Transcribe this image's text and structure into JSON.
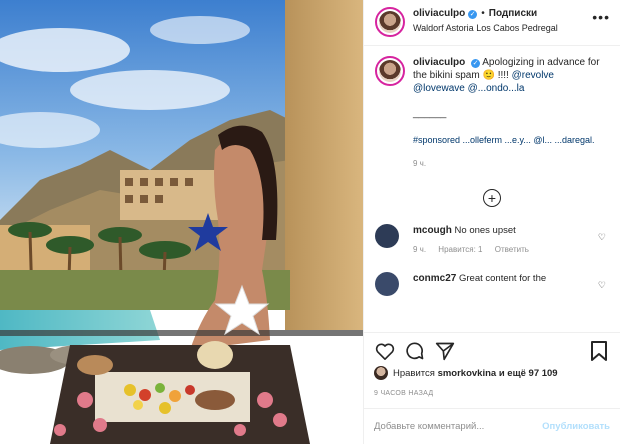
{
  "post": {
    "username": "oliviaculpo",
    "follow_label": "Подписки",
    "location": "Waldorf Astoria Los Cabos Pedregal",
    "more_icon": "more-dots-icon"
  },
  "caption": {
    "username": "oliviaculpo",
    "text": "Apologizing in advance for the bikini spam 🙂 !!!! ",
    "link1": "@revolve @lovewave @...ondo...la",
    "separator": "______",
    "sponsored": "#sponsored ...olleferm ...e.y... @l... ...daregal.",
    "time": "9 ч."
  },
  "load_more_icon": "plus-circle-icon",
  "comments": [
    {
      "username": "mcough",
      "text": "No ones upset",
      "time": "9 ч.",
      "likes": "Нравится: 1",
      "reply": "Ответить"
    },
    {
      "username": "conmc27",
      "text": "Great content for the"
    }
  ],
  "likes": {
    "prefix": "Нравится",
    "user": "smorkovkina",
    "suffix": "и ещё 97 109"
  },
  "ago": "9 ЧАСОВ НАЗАД",
  "comment_box": {
    "placeholder": "Добавьте комментарий...",
    "publish": "Опубликовать"
  },
  "photo": {
    "stickers": [
      "blue-star",
      "white-star"
    ],
    "colors": {
      "sky": "#4a8fd6",
      "pool": "#5fc0c8",
      "wall": "#c9a46a"
    }
  }
}
